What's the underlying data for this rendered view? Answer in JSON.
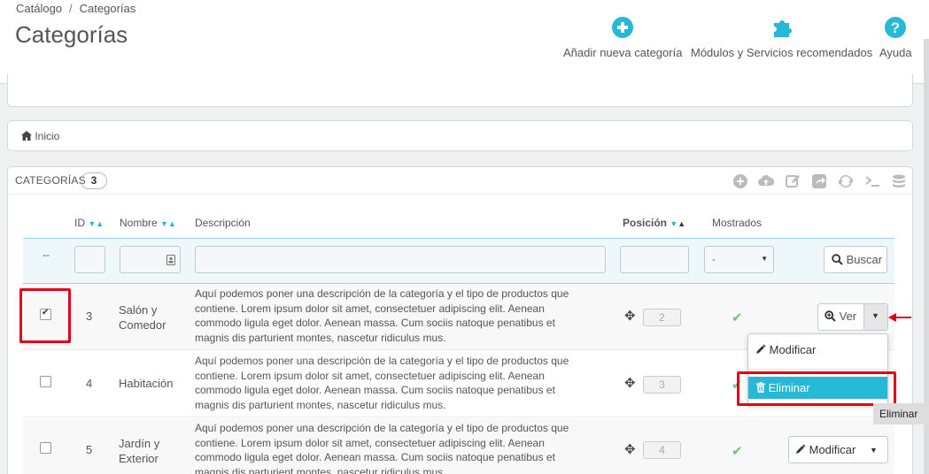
{
  "breadcrumb": {
    "parent": "Catálogo",
    "current": "Categorías"
  },
  "page_title": "Categorías",
  "toolbar": {
    "add": "Añadir nueva categoría",
    "modules": "Módulos y Servicios recomendados",
    "help": "Ayuda"
  },
  "nav": {
    "home": "Inicio"
  },
  "list": {
    "heading": "CATEGORÍAS",
    "count": "3",
    "header_icons": [
      "add-icon",
      "upload-icon",
      "edit-icon",
      "export-icon",
      "refresh-icon",
      "terminal-icon",
      "database-icon"
    ],
    "columns": {
      "id": "ID",
      "name": "Nombre",
      "description": "Descripción",
      "position": "Posición",
      "displayed": "Mostrados"
    },
    "filter": {
      "dash": "--",
      "select_value": "-",
      "search_button": "Buscar"
    },
    "rows": [
      {
        "checked": true,
        "id": "3",
        "name_line1": "Salón y",
        "name_line2": "Comedor",
        "desc": [
          "Aquí podemos poner una descripción de la categoría y el tipo de productos que",
          "contiene. Lorem ipsum dolor sit amet, consectetuer adipiscing elit. Aenean",
          "commodo ligula eget dolor. Aenean massa. Cum sociis natoque penatibus et",
          "magnis dis parturient montes, nascetur ridiculus mus."
        ],
        "position": "2",
        "action": "Ver"
      },
      {
        "checked": false,
        "id": "4",
        "name_line1": "Habitación",
        "name_line2": "",
        "desc": [
          "Aquí podemos poner una descripción de la categoría y el tipo de productos que",
          "contiene. Lorem ipsum dolor sit amet, consectetuer adipiscing elit. Aenean",
          "commodo ligula eget dolor. Aenean massa. Cum sociis natoque penatibus et",
          "magnis dis parturient montes, nascetur ridiculus mus."
        ],
        "position": "3",
        "action": ""
      },
      {
        "checked": false,
        "id": "5",
        "name_line1": "Jardín y",
        "name_line2": "Exterior",
        "desc": [
          "Aquí podemos poner una descripción de la categoría y el tipo de productos que",
          "contiene. Lorem ipsum dolor sit amet, consectetuer adipiscing elit. Aenean",
          "commodo ligula eget dolor. Aenean massa. Cum sociis natoque penatibus et",
          "magnis dis parturient montes, nascetur ridiculus mus."
        ],
        "position": "4",
        "action": "Modificar"
      }
    ]
  },
  "dropdown": {
    "modify": "Modificar",
    "delete": "Eliminar"
  },
  "tooltip": "Eliminar",
  "colors": {
    "accent": "#25b9d7",
    "annotation": "#e2001a",
    "check": "#72c279"
  }
}
